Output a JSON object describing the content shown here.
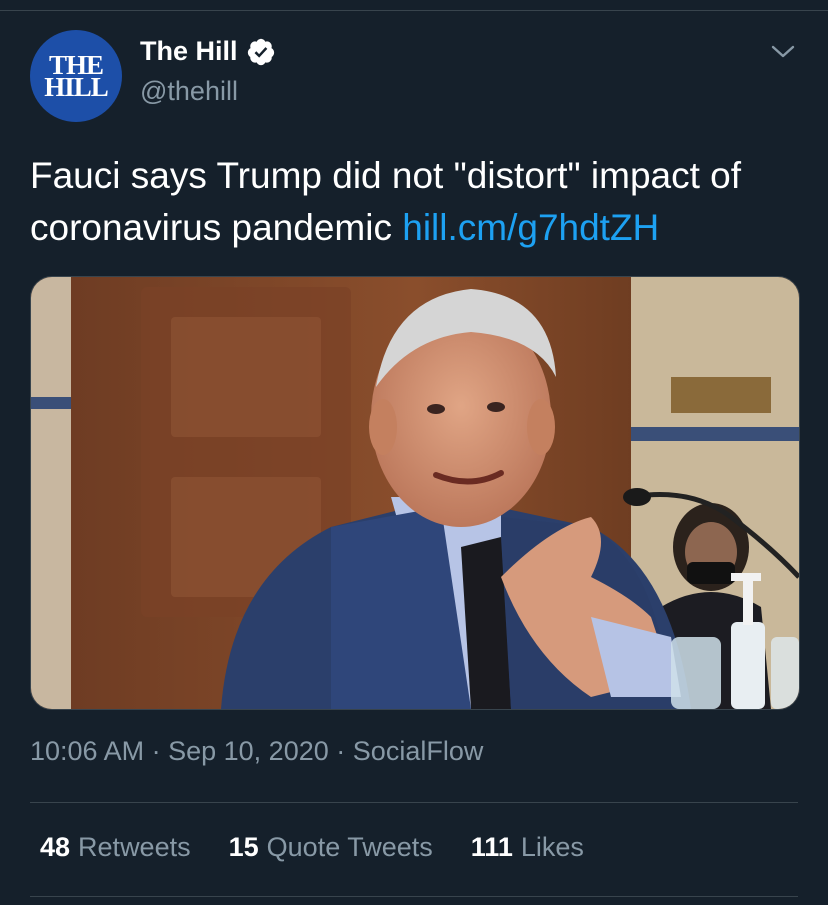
{
  "account": {
    "avatar_line1": "THE",
    "avatar_line2": "HILL",
    "name": "The Hill",
    "handle": "@thehill",
    "verified": true
  },
  "tweet": {
    "text": "Fauci says Trump did not \"distort\" impact of coronavirus pandemic",
    "link": "hill.cm/g7hdtZH",
    "time": "10:06 AM",
    "date": "Sep 10, 2020",
    "source": "SocialFlow",
    "separator": "·"
  },
  "stats": {
    "retweets_count": "48",
    "retweets_label": "Retweets",
    "quotes_count": "15",
    "quotes_label": "Quote Tweets",
    "likes_count": "111",
    "likes_label": "Likes"
  },
  "colors": {
    "background": "#15202b",
    "link": "#1da1f2",
    "secondary_text": "#8899a6",
    "divider": "#38444d"
  },
  "icons": {
    "verified": "verified-badge-icon",
    "menu": "chevron-down-icon"
  }
}
